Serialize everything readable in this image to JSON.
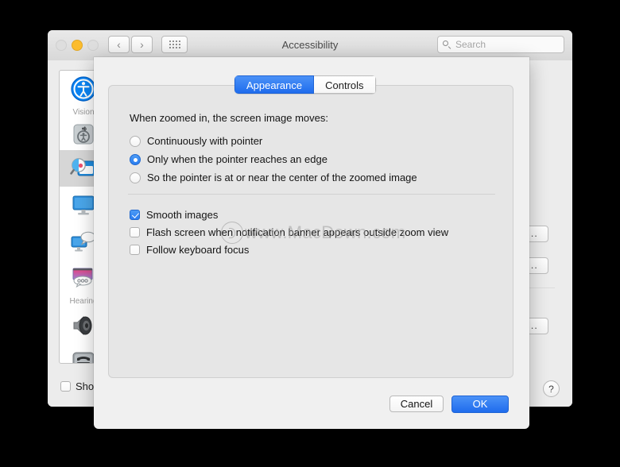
{
  "window": {
    "title": "Accessibility",
    "traffic_lights": [
      "close",
      "minimize",
      "zoom"
    ],
    "nav_back": "‹",
    "nav_forward": "›",
    "grid_icon": "grid-icon",
    "search": {
      "placeholder": "Search",
      "value": ""
    },
    "show_status_label": "Show",
    "show_status_checked": false,
    "help_label": "?",
    "stub_buttons": [
      "...",
      "...",
      "..."
    ]
  },
  "sidebar": {
    "items": [
      {
        "name": "vision-accessibility",
        "icon": "accessibility-person-icon"
      },
      {
        "name": "group-label-vision",
        "label": "Vision"
      },
      {
        "name": "voiceover",
        "icon": "voiceover-icon"
      },
      {
        "name": "zoom",
        "icon": "zoom-magnifier-icon",
        "selected": true
      },
      {
        "name": "display",
        "icon": "display-monitor-icon"
      },
      {
        "name": "descriptions",
        "icon": "descriptions-speech-icon"
      },
      {
        "name": "captions",
        "icon": "captions-icon"
      },
      {
        "name": "group-label-hearing",
        "label": "Hearing"
      },
      {
        "name": "audio",
        "icon": "speaker-icon"
      },
      {
        "name": "tty",
        "icon": "tty-phone-icon"
      }
    ]
  },
  "sheet": {
    "tabs": [
      {
        "label": "Appearance",
        "active": true
      },
      {
        "label": "Controls",
        "active": false
      }
    ],
    "heading": "When zoomed in, the screen image moves:",
    "radio_options": [
      {
        "label": "Continuously with pointer",
        "selected": false
      },
      {
        "label": "Only when the pointer reaches an edge",
        "selected": true
      },
      {
        "label": "So the pointer is at or near the center of the zoomed image",
        "selected": false
      }
    ],
    "checkbox_options": [
      {
        "label": "Smooth images",
        "checked": true
      },
      {
        "label": "Flash screen when notification banner appears outside zoom view",
        "checked": false
      },
      {
        "label": "Follow keyboard focus",
        "checked": false
      }
    ],
    "buttons": {
      "cancel": "Cancel",
      "ok": "OK"
    }
  },
  "watermark": {
    "text": "www.MacDown.com"
  },
  "colors": {
    "accent_blue": "#2a7df0",
    "window_bg": "#ececec",
    "sheet_bg": "#f0f0f0",
    "panel_bg": "#e6e6e6",
    "text": "#141414",
    "muted_text": "#9b9b9b"
  }
}
